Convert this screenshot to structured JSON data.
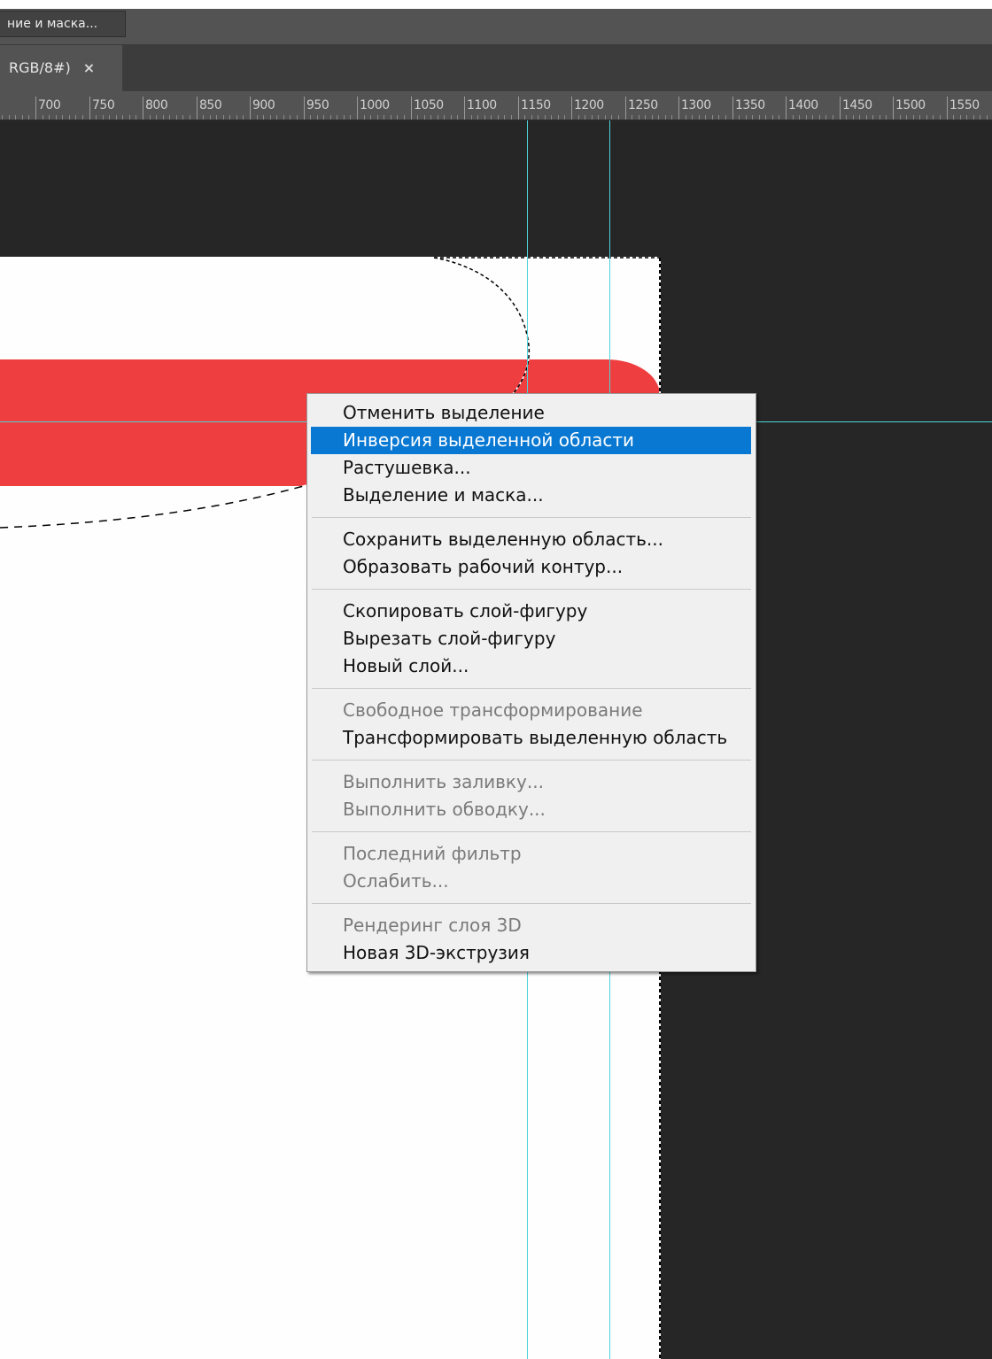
{
  "options_bar": {
    "select_mask_label": "ние и маска..."
  },
  "document_tab": {
    "title": "RGB/8#)",
    "close_symbol": "×"
  },
  "ruler": {
    "labels": [
      "700",
      "750",
      "800",
      "850",
      "900",
      "950",
      "1000",
      "1050",
      "1100",
      "1150",
      "1200",
      "1250",
      "1300",
      "1350",
      "1400",
      "1450",
      "1500",
      "1550"
    ]
  },
  "colors": {
    "shape_fill": "#ef3e40",
    "guide": "#4fd3d9",
    "pasteboard": "#262626",
    "menu_highlight": "#0878d3"
  },
  "context_menu": {
    "groups": [
      [
        {
          "label": "Отменить выделение",
          "enabled": true
        },
        {
          "label": "Инверсия выделенной области",
          "enabled": true,
          "highlighted": true
        },
        {
          "label": "Растушевка...",
          "enabled": true
        },
        {
          "label": "Выделение и маска...",
          "enabled": true
        }
      ],
      [
        {
          "label": "Сохранить выделенную область...",
          "enabled": true
        },
        {
          "label": "Образовать рабочий контур...",
          "enabled": true
        }
      ],
      [
        {
          "label": "Скопировать слой-фигуру",
          "enabled": true
        },
        {
          "label": "Вырезать слой-фигуру",
          "enabled": true
        },
        {
          "label": "Новый слой...",
          "enabled": true
        }
      ],
      [
        {
          "label": "Свободное трансформирование",
          "enabled": false
        },
        {
          "label": "Трансформировать выделенную область",
          "enabled": true
        }
      ],
      [
        {
          "label": "Выполнить заливку...",
          "enabled": false
        },
        {
          "label": "Выполнить обводку...",
          "enabled": false
        }
      ],
      [
        {
          "label": "Последний фильтр",
          "enabled": false
        },
        {
          "label": "Ослабить...",
          "enabled": false
        }
      ],
      [
        {
          "label": "Рендеринг слоя 3D",
          "enabled": false
        },
        {
          "label": "Новая 3D-экструзия",
          "enabled": true
        }
      ]
    ]
  }
}
